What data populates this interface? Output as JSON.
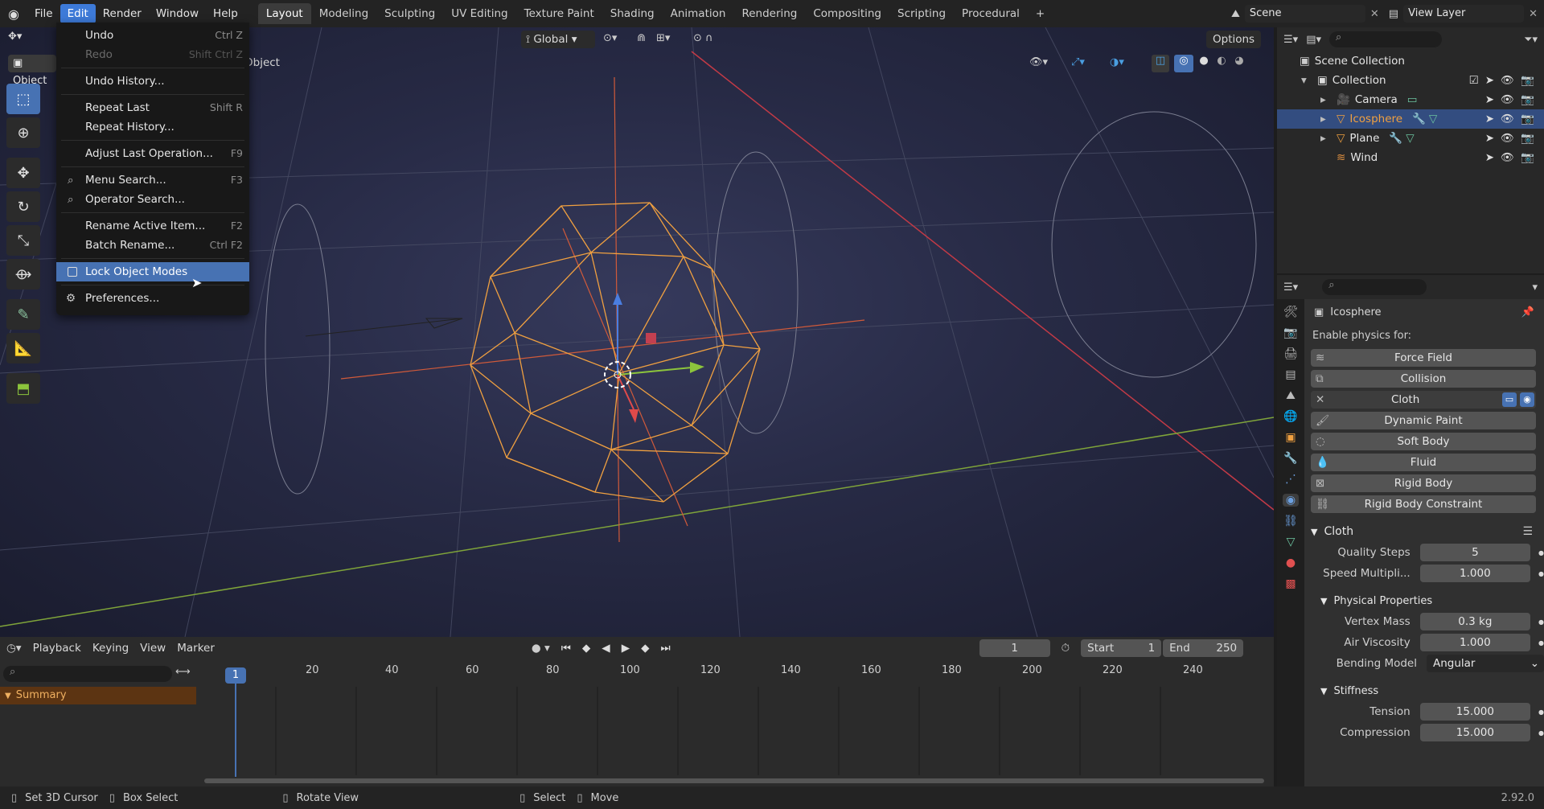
{
  "topbar": {
    "menus": [
      "File",
      "Edit",
      "Render",
      "Window",
      "Help"
    ],
    "workspaces": [
      "Layout",
      "Modeling",
      "Sculpting",
      "UV Editing",
      "Texture Paint",
      "Shading",
      "Animation",
      "Rendering",
      "Compositing",
      "Scripting",
      "Procedural"
    ],
    "scene": "Scene",
    "view_layer": "View Layer"
  },
  "viewport": {
    "mode": "Object",
    "orientation": "Global",
    "options": "Options",
    "object_label": "Object"
  },
  "edit_menu": {
    "items": [
      {
        "label": "Undo",
        "shortcut": "Ctrl Z"
      },
      {
        "label": "Redo",
        "shortcut": "Shift Ctrl Z"
      },
      {
        "label": "Undo History...",
        "shortcut": ""
      },
      {
        "label": "Repeat Last",
        "shortcut": "Shift R"
      },
      {
        "label": "Repeat History...",
        "shortcut": ""
      },
      {
        "label": "Adjust Last Operation...",
        "shortcut": "F9"
      },
      {
        "label": "Menu Search...",
        "shortcut": "F3"
      },
      {
        "label": "Operator Search...",
        "shortcut": ""
      },
      {
        "label": "Rename Active Item...",
        "shortcut": "F2"
      },
      {
        "label": "Batch Rename...",
        "shortcut": "Ctrl F2"
      },
      {
        "label": "Lock Object Modes",
        "shortcut": ""
      },
      {
        "label": "Preferences...",
        "shortcut": ""
      }
    ]
  },
  "outliner": {
    "root": "Scene Collection",
    "collection": "Collection",
    "items": [
      "Camera",
      "Icosphere",
      "Plane",
      "Wind"
    ]
  },
  "properties": {
    "object_name": "Icosphere",
    "enable_label": "Enable physics for:",
    "physics": [
      "Force Field",
      "Collision",
      "Cloth",
      "Dynamic Paint",
      "Soft Body",
      "Fluid",
      "Rigid Body",
      "Rigid Body Constraint"
    ],
    "cloth_panel": "Cloth",
    "quality_steps_label": "Quality Steps",
    "quality_steps": "5",
    "speed_label": "Speed Multipli...",
    "speed": "1.000",
    "physical_panel": "Physical Properties",
    "vertex_mass_label": "Vertex Mass",
    "vertex_mass": "0.3 kg",
    "air_viscosity_label": "Air Viscosity",
    "air_viscosity": "1.000",
    "bending_label": "Bending Model",
    "bending": "Angular",
    "stiffness_panel": "Stiffness",
    "tension_label": "Tension",
    "tension": "15.000",
    "compression_label": "Compression",
    "compression": "15.000"
  },
  "timeline": {
    "menus": [
      "Playback",
      "Keying",
      "View",
      "Marker"
    ],
    "current_frame": "1",
    "start_label": "Start",
    "start": "1",
    "end_label": "End",
    "end": "250",
    "summary": "Summary",
    "ticks": [
      "1",
      "20",
      "40",
      "60",
      "80",
      "100",
      "120",
      "140",
      "160",
      "180",
      "200",
      "220",
      "240"
    ]
  },
  "status": {
    "items": [
      "Set 3D Cursor",
      "Box Select",
      "Rotate View",
      "Select",
      "Move"
    ],
    "version": "2.92.0"
  },
  "colors": {
    "accent": "#4772b3",
    "selected_wire": "#f09a3c",
    "x_axis": "#d33e45",
    "y_axis": "#8cb43c"
  }
}
